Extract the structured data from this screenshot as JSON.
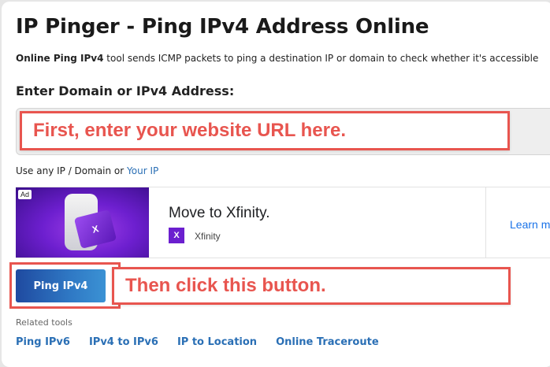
{
  "page": {
    "title": "IP Pinger - Ping IPv4 Address Online",
    "desc_bold": "Online Ping IPv4",
    "desc_rest": " tool sends ICMP packets to ping a destination IP or domain to check whether it's accessible"
  },
  "form": {
    "label": "Enter Domain or IPv4 Address:",
    "input_value": "",
    "hint_prefix": "Use any IP / Domain or ",
    "hint_link": "Your IP",
    "button_label": "Ping IPv4"
  },
  "annotations": {
    "step1": "First, enter your website URL here.",
    "step2": "Then click this button.",
    "color": "#e8554f"
  },
  "ad": {
    "badge": "Ad",
    "title": "Move to Xfinity.",
    "brand": "Xfinity",
    "logo_letter": "X",
    "cta": "Learn m",
    "brand_color": "#6b1fcf"
  },
  "related": {
    "label": "Related tools",
    "links": [
      "Ping IPv6",
      "IPv4 to IPv6",
      "IP to Location",
      "Online Traceroute"
    ]
  },
  "colors": {
    "link": "#2a6fb5",
    "button_start": "#1f4aa0",
    "button_end": "#3b92d4"
  }
}
